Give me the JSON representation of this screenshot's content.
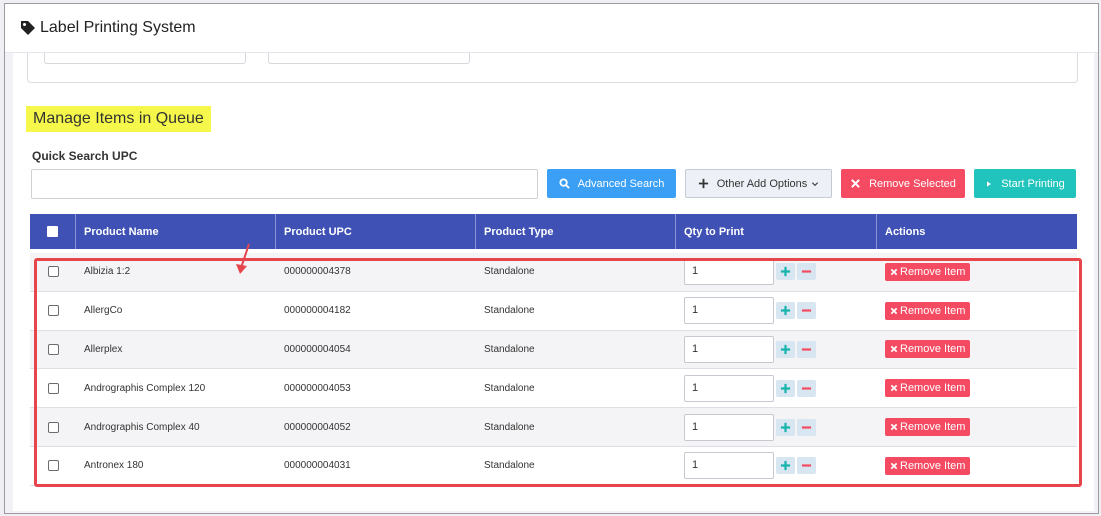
{
  "header": {
    "title": "Label Printing System",
    "icon": "tag-icon"
  },
  "section": {
    "title": "Manage Items in Queue"
  },
  "quick_search": {
    "label": "Quick Search UPC",
    "value": "",
    "placeholder": ""
  },
  "toolbar": {
    "advanced_search": "Advanced Search",
    "other_add_options": "Other Add Options",
    "remove_selected": "Remove Selected",
    "start_printing": "Start Printing"
  },
  "table": {
    "columns": [
      "",
      "Product Name",
      "Product UPC",
      "Product Type",
      "Qty to Print",
      "Actions"
    ],
    "remove_label": "Remove Item",
    "rows": [
      {
        "name": "Albizia 1:2",
        "upc": "000000004378",
        "type": "Standalone",
        "qty": "1"
      },
      {
        "name": "AllergCo",
        "upc": "000000004182",
        "type": "Standalone",
        "qty": "1"
      },
      {
        "name": "Allerplex",
        "upc": "000000004054",
        "type": "Standalone",
        "qty": "1"
      },
      {
        "name": "Andrographis Complex 120",
        "upc": "000000004053",
        "type": "Standalone",
        "qty": "1"
      },
      {
        "name": "Andrographis Complex 40",
        "upc": "000000004052",
        "type": "Standalone",
        "qty": "1"
      },
      {
        "name": "Antronex 180",
        "upc": "000000004031",
        "type": "Standalone",
        "qty": "1"
      }
    ]
  },
  "colors": {
    "header_blue": "#3f51b5",
    "primary": "#3ba0f5",
    "danger": "#f44b62",
    "success": "#20c4bc",
    "highlight": "#f5f84a",
    "annotation": "#e6454c"
  }
}
